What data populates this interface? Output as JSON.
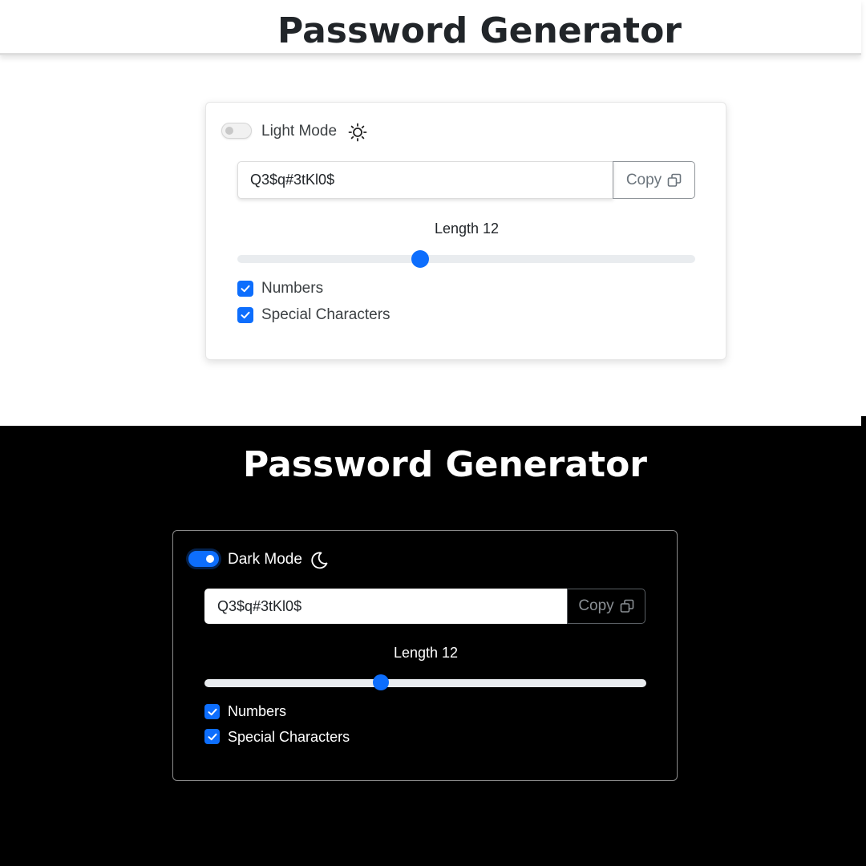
{
  "light": {
    "title": "Password Generator",
    "mode_label": "Light Mode",
    "mode_icon": "sun-icon",
    "toggle_on": false,
    "password": "Q3$q#3tKl0$",
    "copy_label": "Copy",
    "copy_icon": "copy-icon",
    "length_label": "Length 12",
    "length_fraction": 0.4,
    "options": [
      {
        "label": "Numbers",
        "checked": true
      },
      {
        "label": "Special Characters",
        "checked": true
      }
    ]
  },
  "dark": {
    "title": "Password Generator",
    "mode_label": "Dark Mode",
    "mode_icon": "moon-icon",
    "toggle_on": true,
    "password": "Q3$q#3tKl0$",
    "copy_label": "Copy",
    "copy_icon": "copy-icon",
    "length_label": "Length 12",
    "length_fraction": 0.4,
    "options": [
      {
        "label": "Numbers",
        "checked": true
      },
      {
        "label": "Special Characters",
        "checked": true
      }
    ]
  },
  "colors": {
    "accent": "#0d6efd",
    "light_bg": "#ffffff",
    "dark_bg": "#000000",
    "light_text": "#212529",
    "dark_text": "#ffffff"
  }
}
